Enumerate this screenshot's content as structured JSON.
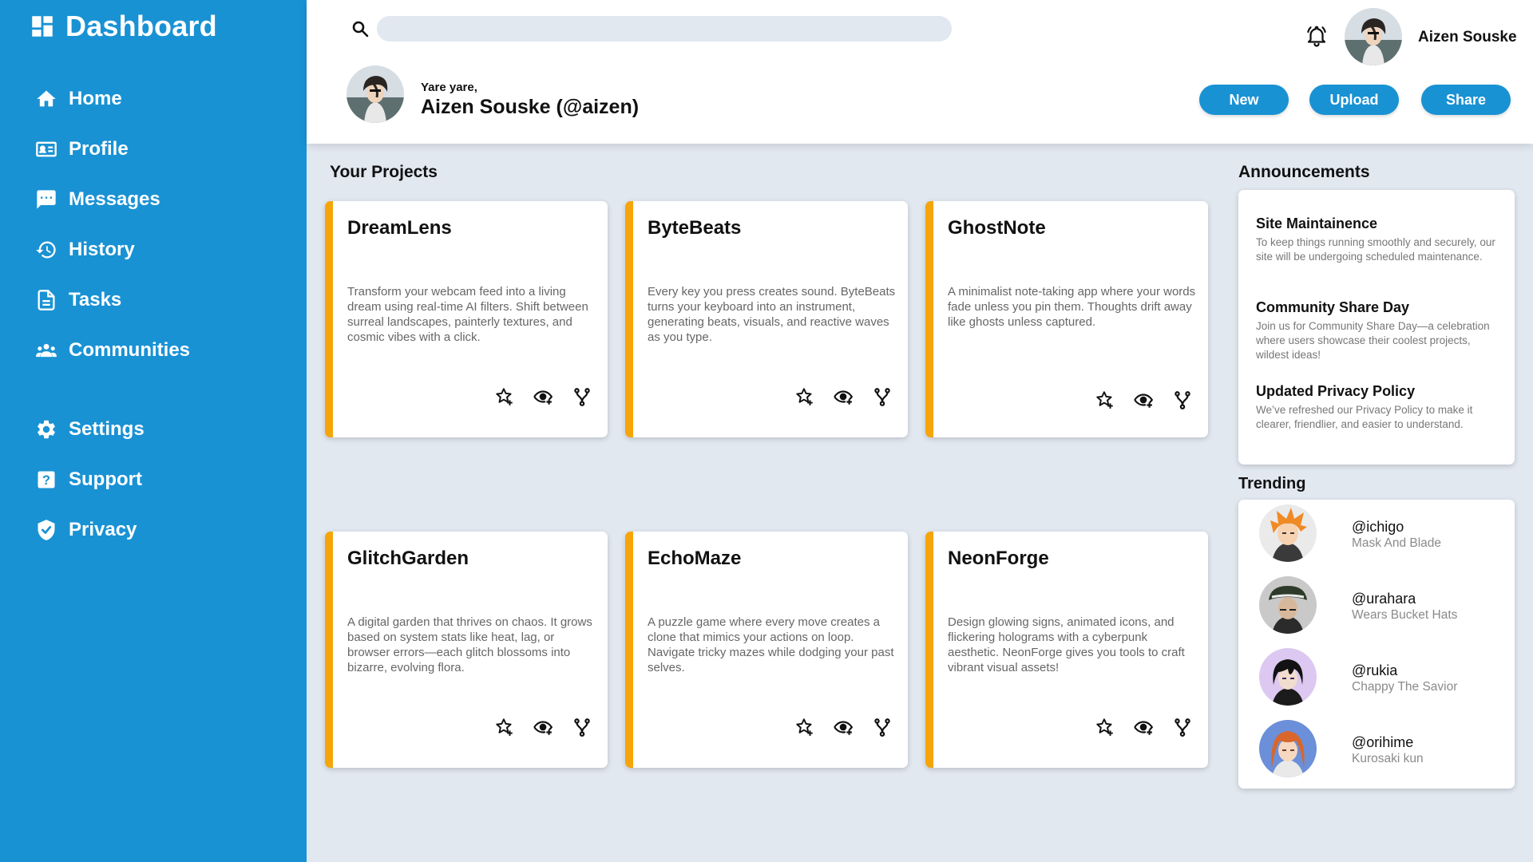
{
  "sidebar": {
    "title": "Dashboard",
    "items": [
      {
        "label": "Home",
        "icon": "home-icon"
      },
      {
        "label": "Profile",
        "icon": "profile-card-icon"
      },
      {
        "label": "Messages",
        "icon": "messages-icon"
      },
      {
        "label": "History",
        "icon": "history-icon"
      },
      {
        "label": "Tasks",
        "icon": "tasks-icon"
      },
      {
        "label": "Communities",
        "icon": "communities-icon"
      }
    ],
    "items_bottom": [
      {
        "label": "Settings",
        "icon": "gear-icon"
      },
      {
        "label": "Support",
        "icon": "help-icon"
      },
      {
        "label": "Privacy",
        "icon": "shield-icon"
      }
    ]
  },
  "header": {
    "search": {
      "placeholder": "",
      "value": ""
    },
    "username": "Aizen Souske",
    "greeting": "Yare yare,",
    "fullname": "Aizen Souske (@aizen)",
    "buttons": {
      "new": "New",
      "upload": "Upload",
      "share": "Share"
    }
  },
  "projects": {
    "title": "Your Projects",
    "items": [
      {
        "name": "DreamLens",
        "description": "Transform your webcam feed into a living dream using real-time AI filters. Shift between surreal landscapes, painterly textures, and cosmic vibes with a click."
      },
      {
        "name": "ByteBeats",
        "description": "Every key you press creates sound. ByteBeats turns your keyboard into an instrument, generating beats, visuals, and reactive waves as you type."
      },
      {
        "name": "GhostNote",
        "description": "A minimalist note-taking app where your words fade unless you pin them. Thoughts drift away like ghosts unless captured."
      },
      {
        "name": "GlitchGarden",
        "description": "A digital garden that thrives on chaos. It grows based on system stats like heat, lag, or browser errors—each glitch blossoms into bizarre, evolving flora."
      },
      {
        "name": "EchoMaze",
        "description": "A puzzle game where every move creates a clone that mimics your actions on loop. Navigate tricky mazes while dodging your past selves."
      },
      {
        "name": "NeonForge",
        "description": "Design glowing signs, animated icons, and flickering holograms with a cyberpunk aesthetic. NeonForge gives you tools to craft vibrant visual assets!"
      }
    ],
    "action_icons": [
      "star-add-icon",
      "watch-icon",
      "fork-icon"
    ],
    "accent_color": "#f5a50a"
  },
  "announcements": {
    "title": "Announcements",
    "items": [
      {
        "title": "Site Maintainence",
        "body": "To keep things running smoothly and securely, our site will be undergoing scheduled maintenance."
      },
      {
        "title": "Community Share Day",
        "body": "Join us for Community Share Day—a celebration where users showcase their coolest projects, wildest ideas!"
      },
      {
        "title": "Updated Privacy Policy",
        "body": "We’ve refreshed our Privacy Policy to make it clearer, friendlier, and easier to understand."
      }
    ]
  },
  "trending": {
    "title": "Trending",
    "items": [
      {
        "handle": "@ichigo",
        "subtitle": "Mask And Blade",
        "hair": "#f08a24",
        "skin": "#f6d2b0",
        "bg": "#eaeaea"
      },
      {
        "handle": "@urahara",
        "subtitle": "Wears Bucket Hats",
        "hair": "#2f3b2a",
        "skin": "#d8b89a",
        "bg": "#c9c9c9"
      },
      {
        "handle": "@rukia",
        "subtitle": "Chappy The Savior",
        "hair": "#121212",
        "skin": "#f2dccd",
        "bg": "#dcc8f0"
      },
      {
        "handle": "@orihime",
        "subtitle": "Kurosaki kun",
        "hair": "#d9662a",
        "skin": "#f6d7bf",
        "bg": "#6b8fd8"
      }
    ]
  },
  "colors": {
    "primary": "#1992d4",
    "background": "#e2e8f0",
    "accent": "#f5a50a"
  }
}
